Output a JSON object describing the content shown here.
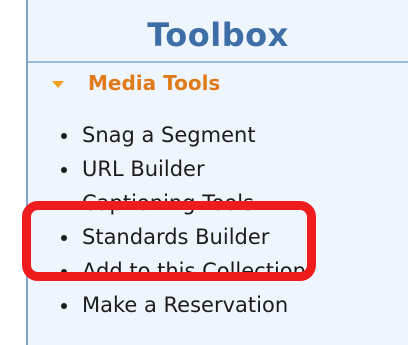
{
  "panel": {
    "title": "Toolbox"
  },
  "section": {
    "label": "Media Tools",
    "expanded": true,
    "icon": "triangle-down-icon",
    "accent_color": "#e07b1a"
  },
  "tools": [
    {
      "label": "Snag a Segment"
    },
    {
      "label": "URL Builder"
    },
    {
      "label": "Captioning Tools"
    },
    {
      "label": "Standards Builder"
    },
    {
      "label": "Add to this Collection"
    },
    {
      "label": "Make a Reservation"
    }
  ],
  "annotation": {
    "color": "#ee1c1c"
  }
}
